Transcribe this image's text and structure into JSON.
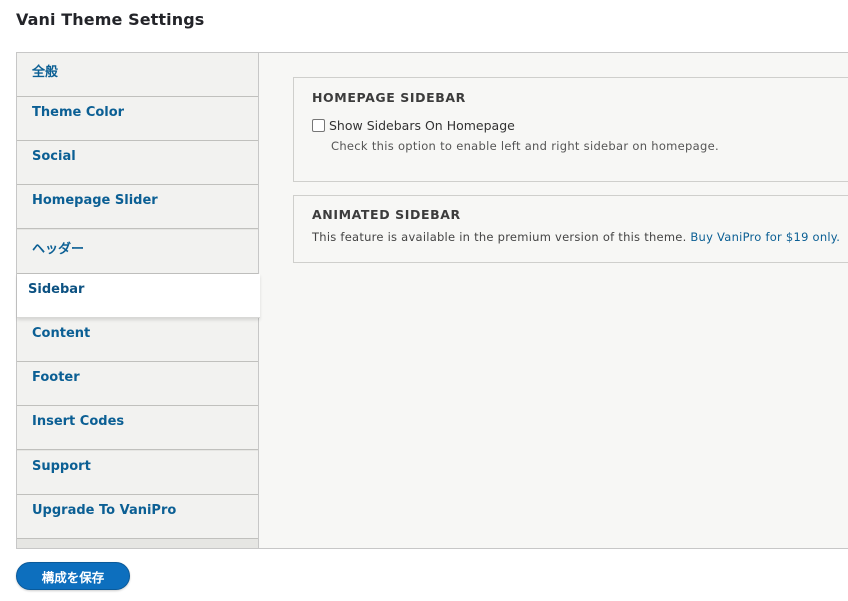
{
  "page": {
    "title": "Vani Theme Settings"
  },
  "tabs": [
    {
      "label": "全般"
    },
    {
      "label": "Theme Color"
    },
    {
      "label": "Social"
    },
    {
      "label": "Homepage Slider"
    },
    {
      "label": "ヘッダー"
    },
    {
      "label": "Sidebar",
      "active": true
    },
    {
      "label": "Content"
    },
    {
      "label": "Footer"
    },
    {
      "label": "Insert Codes"
    },
    {
      "label": "Support"
    },
    {
      "label": "Upgrade To VaniPro"
    }
  ],
  "homepage_sidebar": {
    "title": "HOMEPAGE SIDEBAR",
    "checkbox_label": "Show Sidebars On Homepage",
    "checked": false,
    "description": "Check this option to enable left and right sidebar on homepage."
  },
  "animated_sidebar": {
    "title": "ANIMATED SIDEBAR",
    "text": "This feature is available in the premium version of this theme.",
    "link_text": "Buy VaniPro for $19 only."
  },
  "actions": {
    "save_label": "構成を保存"
  },
  "colors": {
    "link": "#0b5f94",
    "primary_button": "#0d6fbe"
  }
}
